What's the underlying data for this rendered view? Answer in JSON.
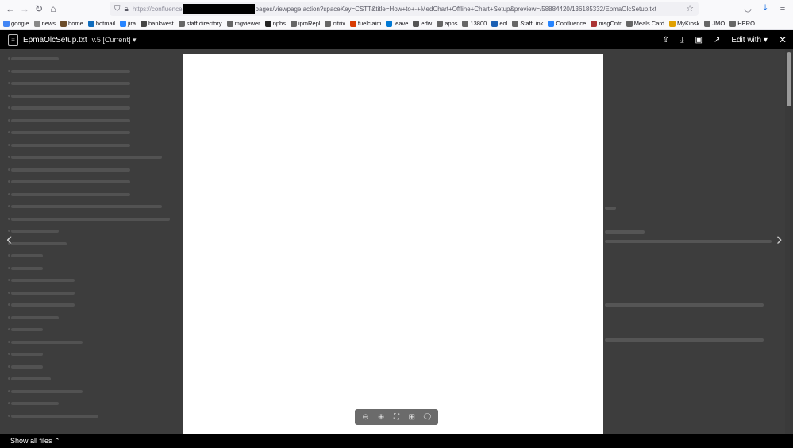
{
  "browser": {
    "back_icon": "arrow-left-icon",
    "forward_icon": "arrow-right-icon",
    "reload_icon": "reload-icon",
    "home_icon": "home-icon",
    "url_host": "https://confluence",
    "url_path": "pages/viewpage.action?spaceKey=CSTT&title=How+to+-+MedChart+Offline+Chart+Setup&preview=/58884420/136185332/EpmaOlcSetup.txt",
    "bookmark_star_icon": "star-icon"
  },
  "bookmarks": [
    {
      "label": "google",
      "color": "#4285f4"
    },
    {
      "label": "news",
      "color": "#888888"
    },
    {
      "label": "home",
      "color": "#6b4c2a"
    },
    {
      "label": "hotmail",
      "color": "#0f6cbd"
    },
    {
      "label": "jira",
      "color": "#2684ff"
    },
    {
      "label": "bankwest",
      "color": "#444444"
    },
    {
      "label": "staff directory",
      "color": "#666666"
    },
    {
      "label": "mgviewer",
      "color": "#666666"
    },
    {
      "label": "npbs",
      "color": "#222222"
    },
    {
      "label": "ipmRepl",
      "color": "#666666"
    },
    {
      "label": "citrix",
      "color": "#666666"
    },
    {
      "label": "fuelclaim",
      "color": "#d83b01"
    },
    {
      "label": "leave",
      "color": "#0078d4"
    },
    {
      "label": "edw",
      "color": "#555555"
    },
    {
      "label": "apps",
      "color": "#666666"
    },
    {
      "label": "13800",
      "color": "#666666"
    },
    {
      "label": "eol",
      "color": "#1a5fb4"
    },
    {
      "label": "StaffLink",
      "color": "#666666"
    },
    {
      "label": "Confluence",
      "color": "#2684ff"
    },
    {
      "label": "msgCntr",
      "color": "#aa3333"
    },
    {
      "label": "Meals Card",
      "color": "#666666"
    },
    {
      "label": "MyKiosk",
      "color": "#e0a000"
    },
    {
      "label": "JMO",
      "color": "#666666"
    },
    {
      "label": "HERO",
      "color": "#666666"
    }
  ],
  "preview": {
    "file_name": "EpmaOlcSetup.txt",
    "version": "v.5 [Current]",
    "edit_with": "Edit with",
    "show_all_files": "Show all files"
  }
}
